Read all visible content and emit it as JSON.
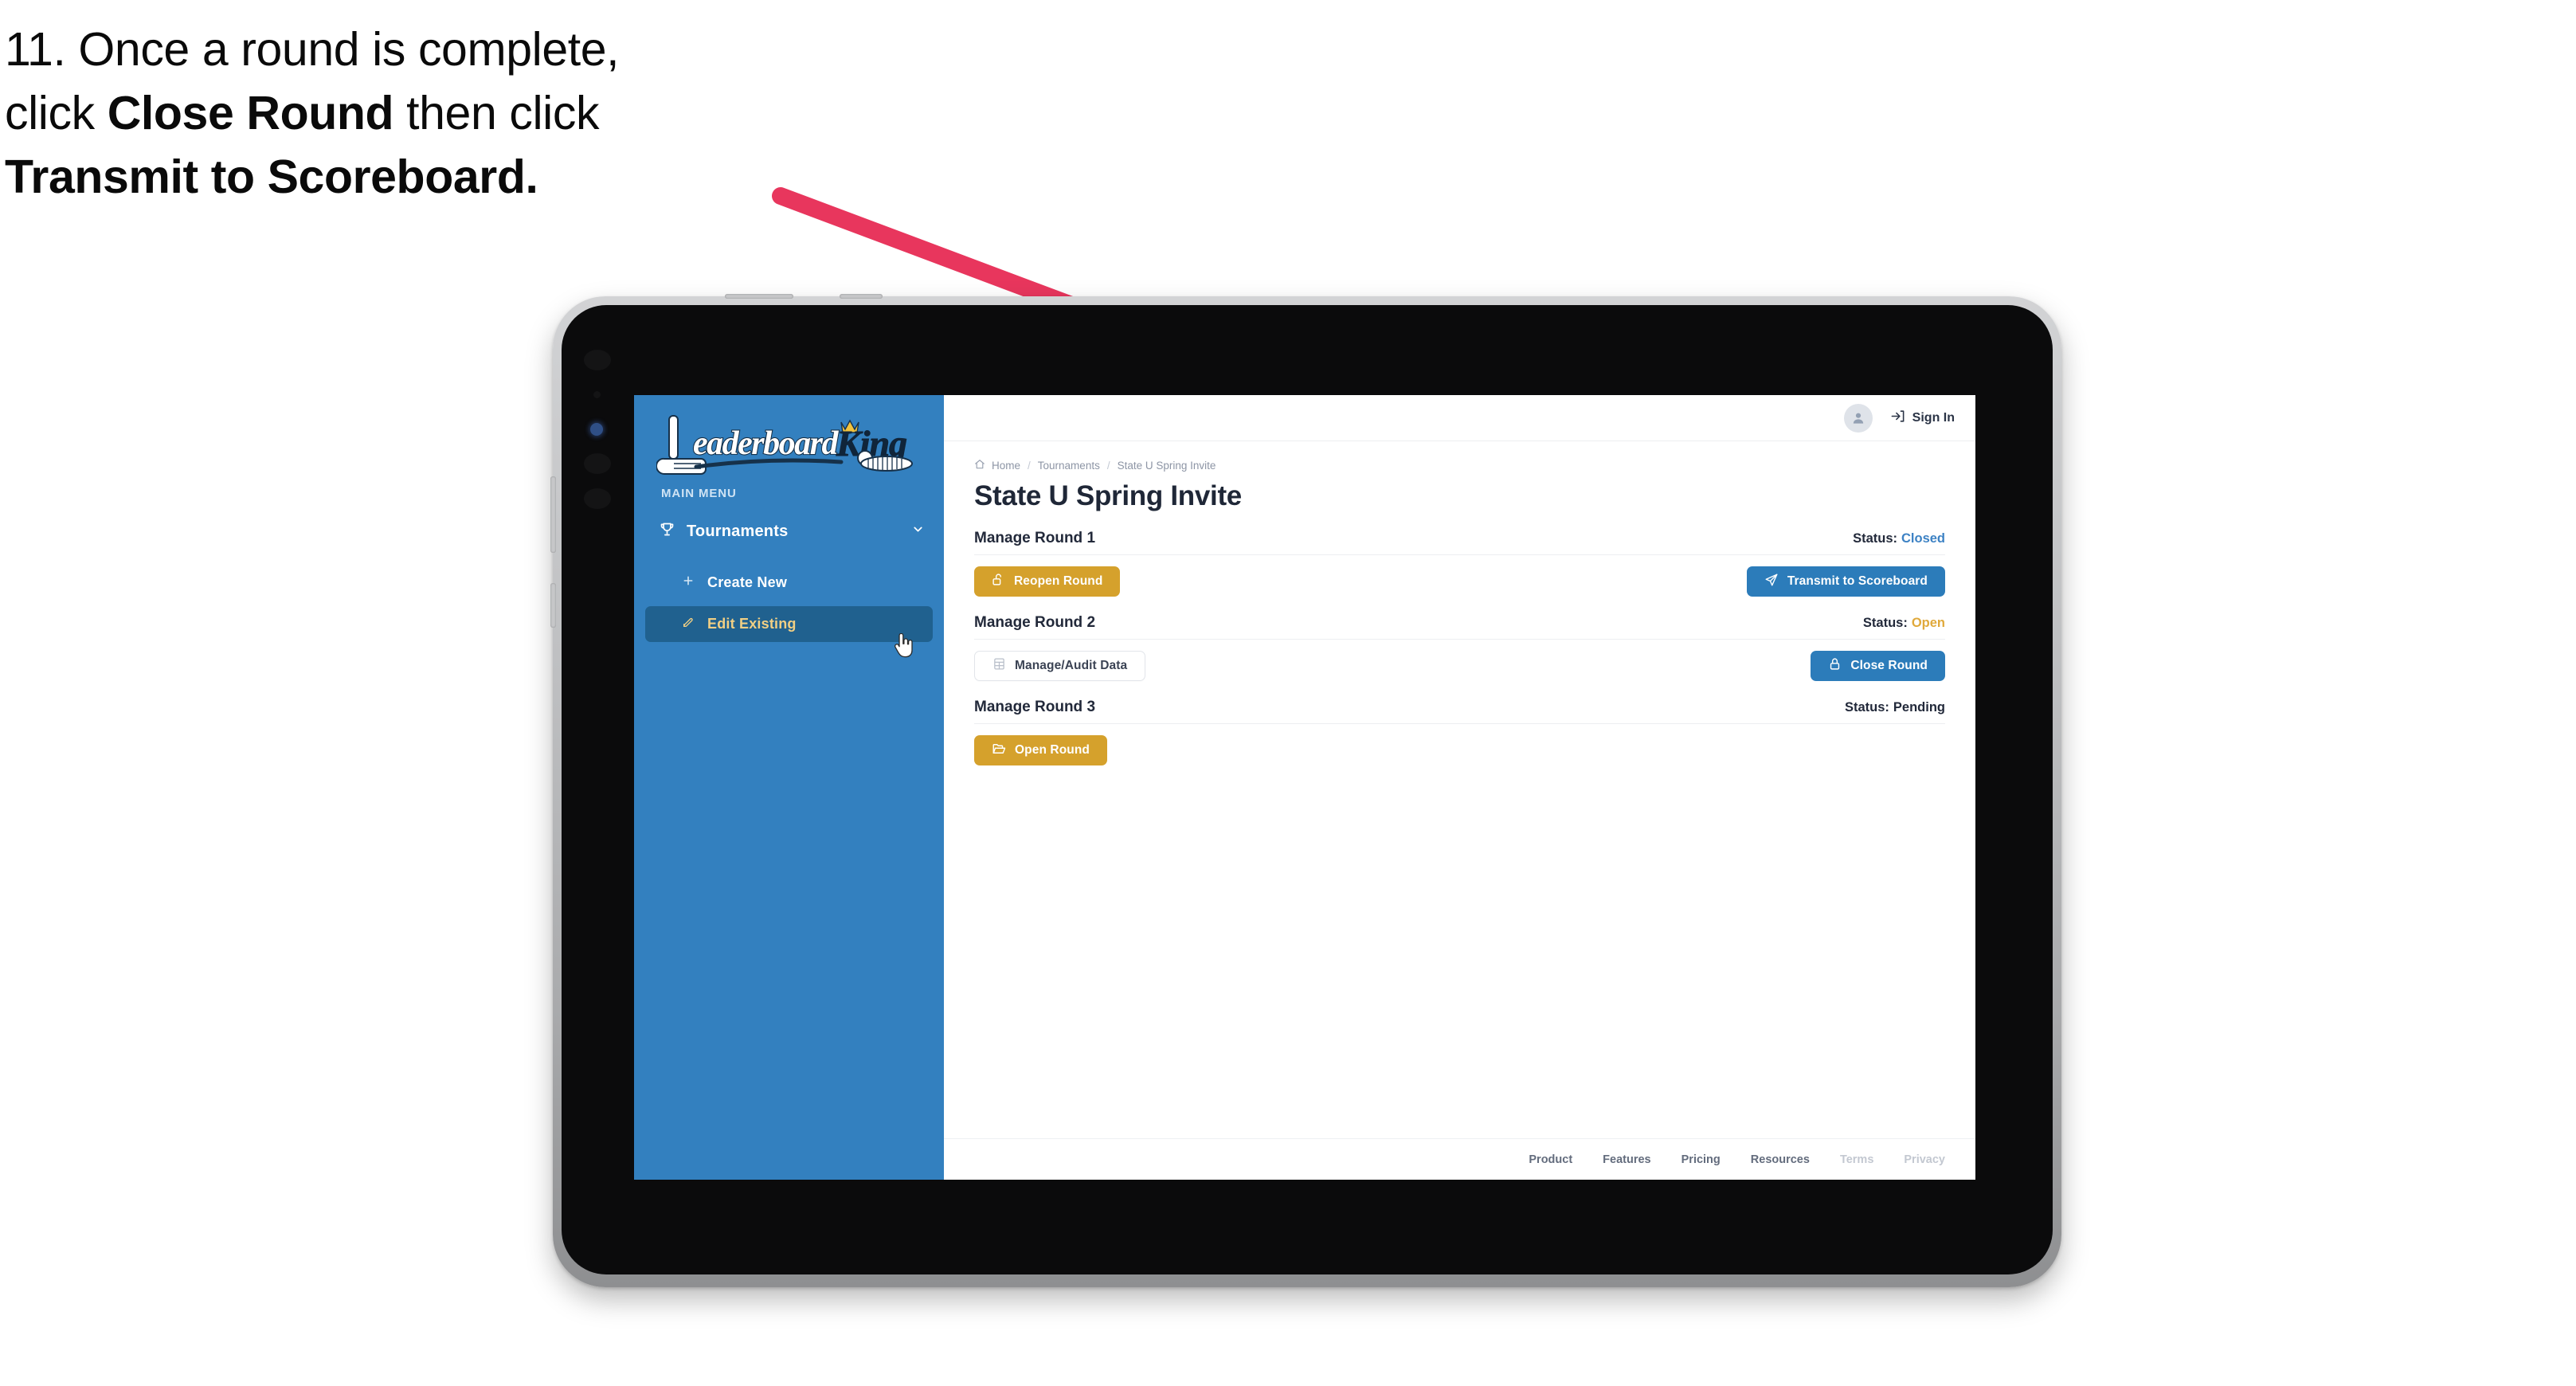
{
  "caption": {
    "line1_prefix": "11. Once a round is complete,",
    "line2_pre": "click ",
    "line2_bold": "Close Round",
    "line2_post": " then click",
    "line3_bold": "Transmit to Scoreboard.",
    "arrow_color": "#E8365D"
  },
  "sidebar": {
    "logo_primary": "Leaderboard",
    "logo_secondary": "King",
    "section_label": "MAIN MENU",
    "items": [
      {
        "label": "Tournaments",
        "icon": "trophy-icon",
        "expand_icon": "chevron-down-icon",
        "active": false
      },
      {
        "label": "Create New",
        "icon": "plus-icon",
        "active": false
      },
      {
        "label": "Edit Existing",
        "icon": "pencil-square-icon",
        "active": true
      }
    ],
    "bg_color": "#3380BF",
    "active_bg_color": "#20618F",
    "active_text_color": "#F0CF84"
  },
  "topbar": {
    "avatar_icon": "user-avatar-icon",
    "signin_icon": "sign-in-arrow-icon",
    "signin_label": "Sign In"
  },
  "breadcrumb": {
    "home_icon": "home-icon",
    "items": [
      "Home",
      "Tournaments",
      "State U Spring Invite"
    ],
    "separator": "/"
  },
  "page": {
    "title": "State U Spring Invite"
  },
  "rounds": [
    {
      "title": "Manage Round 1",
      "status_label": "Status:",
      "status_value": "Closed",
      "status_class": "status-closed",
      "status_color": "#3D82C4",
      "left_button": {
        "label": "Reopen Round",
        "icon": "unlock-icon",
        "style": "gold",
        "name": "reopen-round-button"
      },
      "right_button": {
        "label": "Transmit to Scoreboard",
        "icon": "paper-plane-icon",
        "style": "blue",
        "name": "transmit-to-scoreboard-button"
      }
    },
    {
      "title": "Manage Round 2",
      "status_label": "Status:",
      "status_value": "Open",
      "status_class": "status-open",
      "status_color": "#E0A93B",
      "left_button": {
        "label": "Manage/Audit Data",
        "icon": "table-grid-icon",
        "style": "ghost",
        "name": "manage-audit-data-button"
      },
      "right_button": {
        "label": "Close Round",
        "icon": "lock-icon",
        "style": "blue",
        "name": "close-round-button"
      }
    },
    {
      "title": "Manage Round 3",
      "status_label": "Status:",
      "status_value": "Pending",
      "status_class": "status-pending",
      "status_color": "#22293A",
      "left_button": {
        "label": "Open Round",
        "icon": "folder-open-icon",
        "style": "gold",
        "name": "open-round-button"
      },
      "right_button": null
    }
  ],
  "footer": {
    "links": [
      {
        "label": "Product",
        "muted": false
      },
      {
        "label": "Features",
        "muted": false
      },
      {
        "label": "Pricing",
        "muted": false
      },
      {
        "label": "Resources",
        "muted": false
      },
      {
        "label": "Terms",
        "muted": true
      },
      {
        "label": "Privacy",
        "muted": true
      }
    ]
  },
  "cursor": {
    "icon": "pointer-hand-cursor"
  }
}
